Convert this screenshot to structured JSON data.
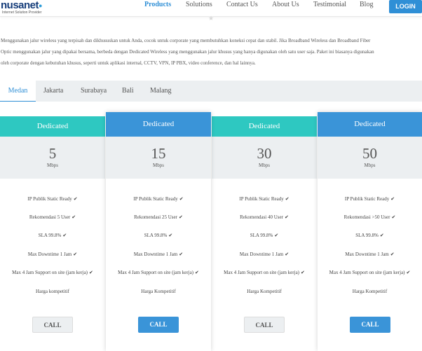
{
  "brand": {
    "name": "nusanet",
    "tagline": "Internet Solution Provider"
  },
  "nav": {
    "products": "Products",
    "solutions": "Solutions",
    "contact": "Contact Us",
    "about": "About Us",
    "testimonial": "Testimonial",
    "blog": "Blog",
    "login": "LOGIN"
  },
  "intro": {
    "line1": "Menggunakan jalur wireless yang terpisah dan dikhususkan untuk Anda, cocok untuk corporate yang membutuhkan koneksi cepat dan stabil. Jika Broadband Wireless dan Broadband Fiber",
    "line2": "Optic menggunakan jalur yang dipakai bersama, berbeda dengan Dedicated Wireless yang menggunakan jalur khusus yang hanya digunakan oleh satu user saja. Paket ini biasanya digunakan",
    "line3": "oleh corporate dengan kebutuhan khusus, seperti untuk aplikasi internal, CCTV, VPN, IP PBX, video conference, dan hal lainnya."
  },
  "tabs": [
    "Medan",
    "Jakarta",
    "Surabaya",
    "Bali",
    "Malang"
  ],
  "cards": [
    {
      "title": "Dedicated",
      "speed": "5",
      "unit": "Mbps",
      "f1": "IP Publik Static Ready",
      "f2": "Rekomendasi 5 User",
      "f3": "SLA 99.8%",
      "f4": "Max Downtime 1 Jam",
      "f5": "Max 4 Jam Support on site (jam kerja)",
      "f6": "Harga kompetitif",
      "cta": "CALL"
    },
    {
      "title": "Dedicated",
      "speed": "15",
      "unit": "Mbps",
      "f1": "IP Publik Static Ready",
      "f2": "Rekomendasi 25 User",
      "f3": "SLA 99.8%",
      "f4": "Max Downtime 1 Jam",
      "f5": "Max 4 Jam Support on site (jam kerja)",
      "f6": "Harga Kompetitif",
      "cta": "CALL"
    },
    {
      "title": "Dedicated",
      "speed": "30",
      "unit": "Mbps",
      "f1": "IP Publik Static Ready",
      "f2": "Rekomendasi 40 User",
      "f3": "SLA 99.8%",
      "f4": "Max Downtime 1 Jam",
      "f5": "Max 4 Jam Support on site (jam kerja)",
      "f6": "Harga Kompetitif",
      "cta": "CALL"
    },
    {
      "title": "Dedicated",
      "speed": "50",
      "unit": "Mbps",
      "f1": "IP Publik Static Ready",
      "f2": "Rekomendasi >50 User",
      "f3": "SLA 99.8%",
      "f4": "Max Downtime 1 Jam",
      "f5": "Max 4 Jam Support on site (jam kerja)",
      "f6": "Harga Kompetitif",
      "cta": "CALL"
    }
  ],
  "colors": {
    "teal": "#2ec8c1",
    "blue": "#3a94d8",
    "grey_bg": "#eceff1"
  },
  "icons": {
    "check": "check-icon",
    "star": "star-icon"
  }
}
